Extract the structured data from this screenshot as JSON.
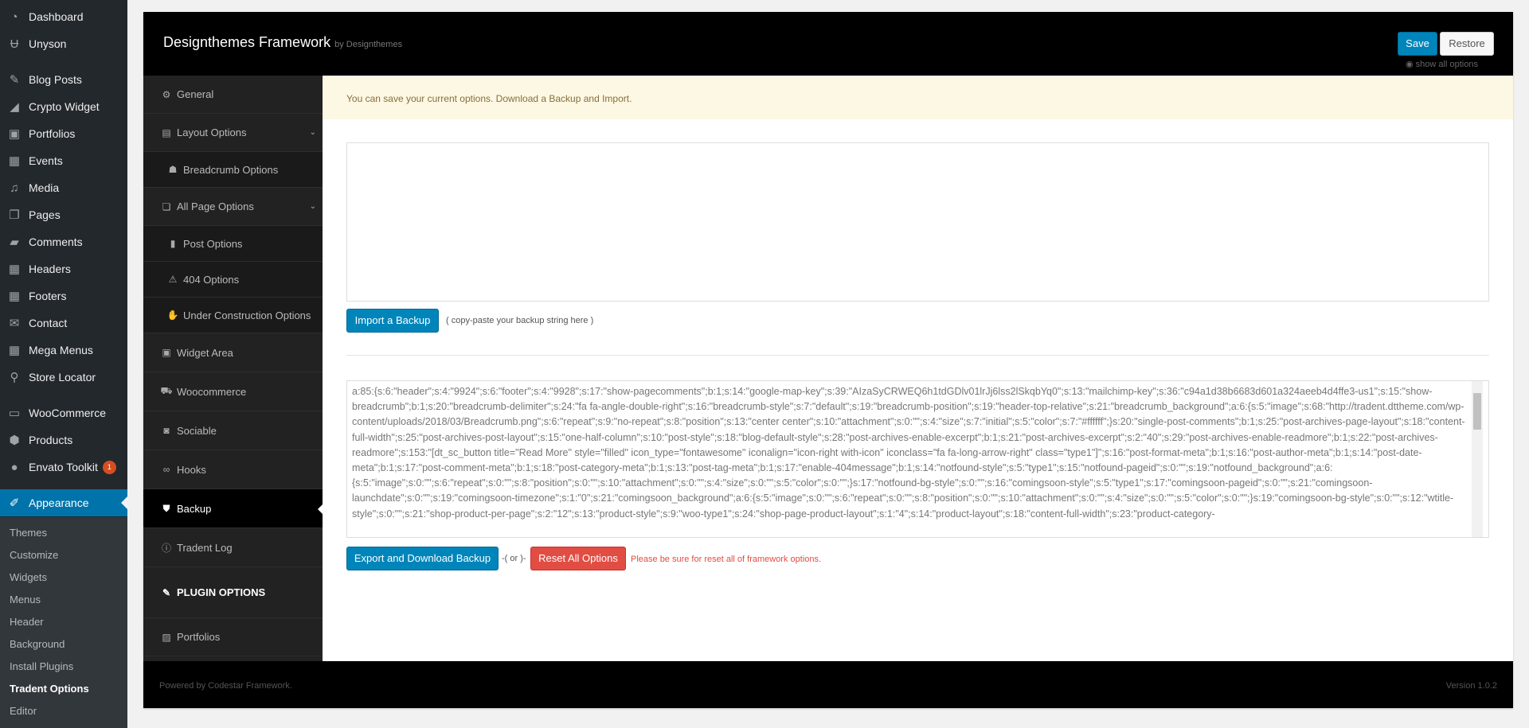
{
  "wp_menu": {
    "items": [
      {
        "label": "Dashboard",
        "icon": "dashboard-icon"
      },
      {
        "label": "Unyson",
        "icon": "unyson-icon"
      },
      {
        "label": "Blog Posts",
        "icon": "pin-icon"
      },
      {
        "label": "Crypto Widget",
        "icon": "chart-icon"
      },
      {
        "label": "Portfolios",
        "icon": "portfolio-icon"
      },
      {
        "label": "Events",
        "icon": "calendar-icon"
      },
      {
        "label": "Media",
        "icon": "media-icon"
      },
      {
        "label": "Pages",
        "icon": "pages-icon"
      },
      {
        "label": "Comments",
        "icon": "comment-icon"
      },
      {
        "label": "Headers",
        "icon": "grid-icon"
      },
      {
        "label": "Footers",
        "icon": "grid-icon"
      },
      {
        "label": "Contact",
        "icon": "mail-icon"
      },
      {
        "label": "Mega Menus",
        "icon": "grid-icon"
      },
      {
        "label": "Store Locator",
        "icon": "location-icon"
      },
      {
        "label": "WooCommerce",
        "icon": "woo-icon"
      },
      {
        "label": "Products",
        "icon": "products-icon"
      },
      {
        "label": "Envato Toolkit",
        "icon": "envato-icon",
        "badge": "1"
      },
      {
        "label": "Appearance",
        "icon": "brush-icon"
      }
    ],
    "appearance_sub": [
      "Themes",
      "Customize",
      "Widgets",
      "Menus",
      "Header",
      "Background",
      "Install Plugins",
      "Tradent Options",
      "Editor"
    ]
  },
  "header": {
    "title": "Designthemes Framework",
    "by": "by Designthemes",
    "save_label": "Save",
    "restore_label": "Restore",
    "show_all": "show all options"
  },
  "nav": {
    "general": "General",
    "layout_options": "Layout Options",
    "breadcrumb_options": "Breadcrumb Options",
    "all_page_options": "All Page Options",
    "post_options": "Post Options",
    "options_404": "404 Options",
    "under_construction": "Under Construction Options",
    "widget_area": "Widget Area",
    "woocommerce": "Woocommerce",
    "sociable": "Sociable",
    "hooks": "Hooks",
    "backup": "Backup",
    "tradent_log": "Tradent Log",
    "plugin_options": "PLUGIN OPTIONS",
    "portfolios": "Portfolios"
  },
  "content": {
    "notice": "You can save your current options. Download a Backup and Import.",
    "import_value": "",
    "import_label": "Import a Backup",
    "import_hint": "( copy-paste your backup string here )",
    "export_text": "a:85:{s:6:\"header\";s:4:\"9924\";s:6:\"footer\";s:4:\"9928\";s:17:\"show-pagecomments\";b:1;s:14:\"google-map-key\";s:39:\"AIzaSyCRWEQ6h1tdGDlv01lrJj6lss2lSkqbYq0\";s:13:\"mailchimp-key\";s:36:\"c94a1d38b6683d601a324aeeb4d4ffe3-us1\";s:15:\"show-breadcrumb\";b:1;s:20:\"breadcrumb-delimiter\";s:24:\"fa fa-angle-double-right\";s:16:\"breadcrumb-style\";s:7:\"default\";s:19:\"breadcrumb-position\";s:19:\"header-top-relative\";s:21:\"breadcrumb_background\";a:6:{s:5:\"image\";s:68:\"http://tradent.dttheme.com/wp-content/uploads/2018/03/Breadcrumb.png\";s:6:\"repeat\";s:9:\"no-repeat\";s:8:\"position\";s:13:\"center center\";s:10:\"attachment\";s:0:\"\";s:4:\"size\";s:7:\"initial\";s:5:\"color\";s:7:\"#ffffff\";}s:20:\"single-post-comments\";b:1;s:25:\"post-archives-page-layout\";s:18:\"content-full-width\";s:25:\"post-archives-post-layout\";s:15:\"one-half-column\";s:10:\"post-style\";s:18:\"blog-default-style\";s:28:\"post-archives-enable-excerpt\";b:1;s:21:\"post-archives-excerpt\";s:2:\"40\";s:29:\"post-archives-enable-readmore\";b:1;s:22:\"post-archives-readmore\";s:153:\"[dt_sc_button title=\"Read More\" style=\"filled\" icon_type=\"fontawesome\" iconalign=\"icon-right with-icon\" iconclass=\"fa fa-long-arrow-right\" class=\"type1\"]\";s:16:\"post-format-meta\";b:1;s:16:\"post-author-meta\";b:1;s:14:\"post-date-meta\";b:1;s:17:\"post-comment-meta\";b:1;s:18:\"post-category-meta\";b:1;s:13:\"post-tag-meta\";b:1;s:17:\"enable-404message\";b:1;s:14:\"notfound-style\";s:5:\"type1\";s:15:\"notfound-pageid\";s:0:\"\";s:19:\"notfound_background\";a:6:{s:5:\"image\";s:0:\"\";s:6:\"repeat\";s:0:\"\";s:8:\"position\";s:0:\"\";s:10:\"attachment\";s:0:\"\";s:4:\"size\";s:0:\"\";s:5:\"color\";s:0:\"\";}s:17:\"notfound-bg-style\";s:0:\"\";s:16:\"comingsoon-style\";s:5:\"type1\";s:17:\"comingsoon-pageid\";s:0:\"\";s:21:\"comingsoon-launchdate\";s:0:\"\";s:19:\"comingsoon-timezone\";s:1:\"0\";s:21:\"comingsoon_background\";a:6:{s:5:\"image\";s:0:\"\";s:6:\"repeat\";s:0:\"\";s:8:\"position\";s:0:\"\";s:10:\"attachment\";s:0:\"\";s:4:\"size\";s:0:\"\";s:5:\"color\";s:0:\"\";}s:19:\"comingsoon-bg-style\";s:0:\"\";s:12:\"wtitle-style\";s:0:\"\";s:21:\"shop-product-per-page\";s:2:\"12\";s:13:\"product-style\";s:9:\"woo-type1\";s:24:\"shop-page-product-layout\";s:1:\"4\";s:14:\"product-layout\";s:18:\"content-full-width\";s:23:\"product-category-",
    "export_label": "Export and Download Backup",
    "or_text": "-( or )-",
    "reset_label": "Reset All Options",
    "reset_warning": "Please be sure for reset all of framework options."
  },
  "footer": {
    "powered": "Powered by Codestar Framework.",
    "version": "Version 1.0.2"
  },
  "colors": {
    "wp_sidebar": "#23282d",
    "wp_accent": "#0073aa",
    "primary_button": "#0085ba",
    "danger": "#e14d43",
    "notice_bg": "#fcf8e3"
  }
}
